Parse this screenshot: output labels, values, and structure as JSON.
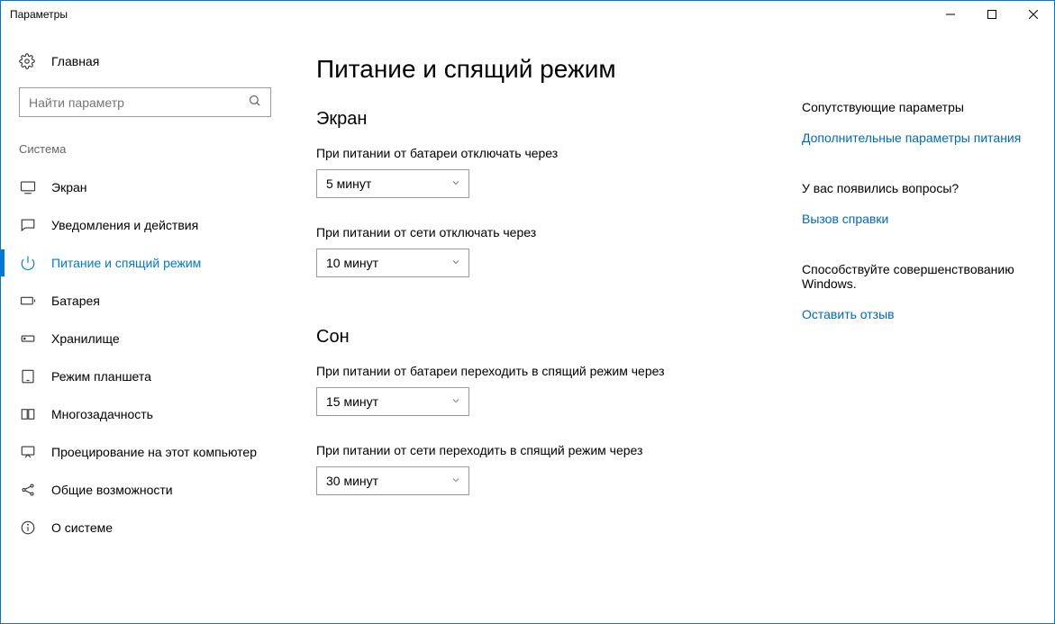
{
  "window": {
    "title": "Параметры"
  },
  "sidebar": {
    "home": "Главная",
    "search_placeholder": "Найти параметр",
    "group": "Система",
    "items": [
      {
        "label": "Экран"
      },
      {
        "label": "Уведомления и действия"
      },
      {
        "label": "Питание и спящий режим"
      },
      {
        "label": "Батарея"
      },
      {
        "label": "Хранилище"
      },
      {
        "label": "Режим планшета"
      },
      {
        "label": "Многозадачность"
      },
      {
        "label": "Проецирование на этот компьютер"
      },
      {
        "label": "Общие возможности"
      },
      {
        "label": "О системе"
      }
    ]
  },
  "main": {
    "title": "Питание и спящий режим",
    "section_screen": "Экран",
    "screen_battery_label": "При питании от батареи отключать через",
    "screen_battery_value": "5 минут",
    "screen_plugged_label": "При питании от сети отключать через",
    "screen_plugged_value": "10 минут",
    "section_sleep": "Сон",
    "sleep_battery_label": "При питании от батареи переходить в спящий режим через",
    "sleep_battery_value": "15 минут",
    "sleep_plugged_label": "При питании от сети переходить в спящий режим через",
    "sleep_plugged_value": "30 минут"
  },
  "right": {
    "related_heading": "Сопутствующие параметры",
    "related_link": "Дополнительные параметры питания",
    "questions_heading": "У вас появились вопросы?",
    "help_link": "Вызов справки",
    "improve_heading": "Способствуйте совершенствованию Windows.",
    "feedback_link": "Оставить отзыв"
  }
}
